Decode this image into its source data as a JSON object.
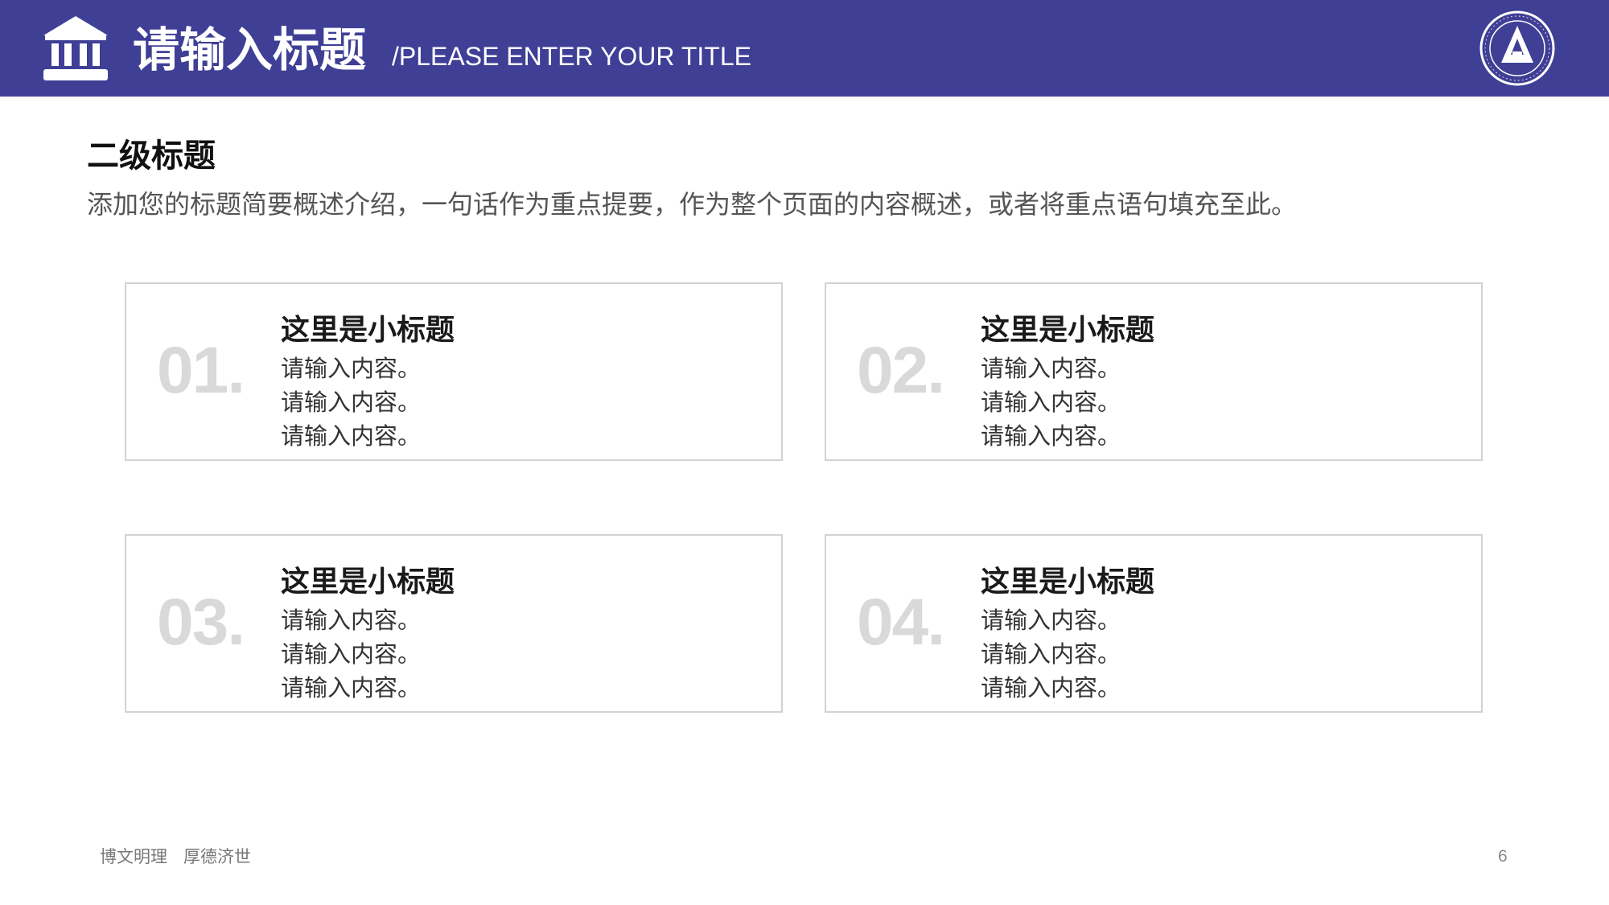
{
  "header": {
    "title": "请输入标题",
    "subtitle": "/PLEASE ENTER YOUR TITLE",
    "icon": "bank-icon",
    "logo": "university-seal-logo",
    "background_color": "#3f3f96"
  },
  "section": {
    "title": "二级标题",
    "description": "添加您的标题简要概述介绍，一句话作为重点提要，作为整个页面的内容概述，或者将重点语句填充至此。"
  },
  "cards": [
    {
      "number": "01.",
      "title": "这里是小标题",
      "lines": [
        "请输入内容。",
        "请输入内容。",
        "请输入内容。"
      ]
    },
    {
      "number": "02.",
      "title": "这里是小标题",
      "lines": [
        "请输入内容。",
        "请输入内容。",
        "请输入内容。"
      ]
    },
    {
      "number": "03.",
      "title": "这里是小标题",
      "lines": [
        "请输入内容。",
        "请输入内容。",
        "请输入内容。"
      ]
    },
    {
      "number": "04.",
      "title": "这里是小标题",
      "lines": [
        "请输入内容。",
        "请输入内容。",
        "请输入内容。"
      ]
    }
  ],
  "footer": {
    "motto": "博文明理   厚德济世",
    "page_number": "6"
  }
}
